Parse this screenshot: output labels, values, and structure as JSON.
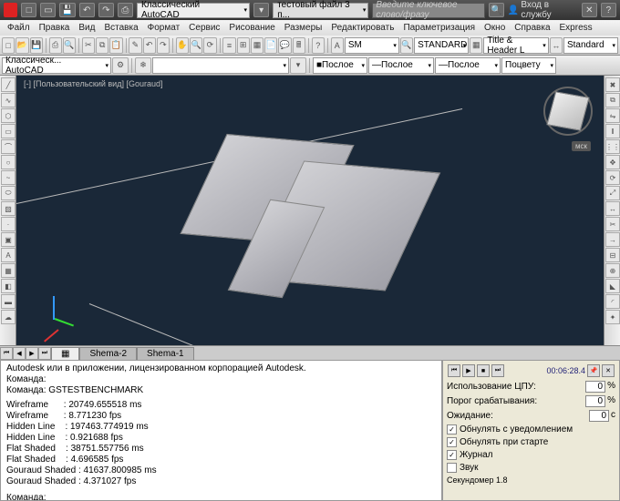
{
  "title": {
    "workspace_dd": "Классический AutoCAD",
    "file_dd": "тестовый файл 3 п...",
    "search_placeholder": "Введите ключевое слово/фразу",
    "login": "Вход в службу"
  },
  "menu": [
    "Файл",
    "Правка",
    "Вид",
    "Вставка",
    "Формат",
    "Сервис",
    "Рисование",
    "Размеры",
    "Редактировать",
    "Параметризация",
    "Окно",
    "Справка",
    "Express"
  ],
  "tb2": {
    "workspace_combo": "Классическ... AutoCAD",
    "prop1": "Послое",
    "prop2": "Послое",
    "prop3": "Послое",
    "prop4": "Поцвету"
  },
  "tb3": {
    "sm": "SM",
    "style": "STANDARD",
    "header": "Title & Header L",
    "dimstyle": "Standard"
  },
  "viewport": {
    "label": "[-] [Пользовательский вид] [Gouraud]",
    "ucs": "мск"
  },
  "tabs": [
    "Shema-2",
    "Shema-1"
  ],
  "cmd": {
    "line1": "Autodesk или в приложении, лицензированном корпорацией Autodesk.",
    "line2": "Команда:",
    "line3": "Команда: GSTESTBENCHMARK",
    "r1a": "Wireframe      : 20749.655518 ms",
    "r1b": "Wireframe      : 8.771230 fps",
    "r2a": "Hidden Line    : 197463.774919 ms",
    "r2b": "Hidden Line    : 0.921688 fps",
    "r3a": "Flat Shaded    : 38751.557756 ms",
    "r3b": "Flat Shaded    : 4.696585 fps",
    "r4a": "Gouraud Shaded : 41637.800985 ms",
    "r4b": "Gouraud Shaded : 4.371027 fps",
    "prompt": "Команда:"
  },
  "bench": {
    "time": "00:06:28.4",
    "cpu_label": "Использование ЦПУ:",
    "cpu_val": "0",
    "cpu_unit": "%",
    "thresh_label": "Порог срабатывания:",
    "thresh_val": "0",
    "thresh_unit": "%",
    "wait_label": "Ожидание:",
    "wait_val": "0",
    "wait_unit": "с",
    "chk1": "Обнулять с уведомлением",
    "chk2": "Обнулять при старте",
    "chk3": "Журнал",
    "chk4": "Звук",
    "footer": "Секундомер 1.8"
  }
}
